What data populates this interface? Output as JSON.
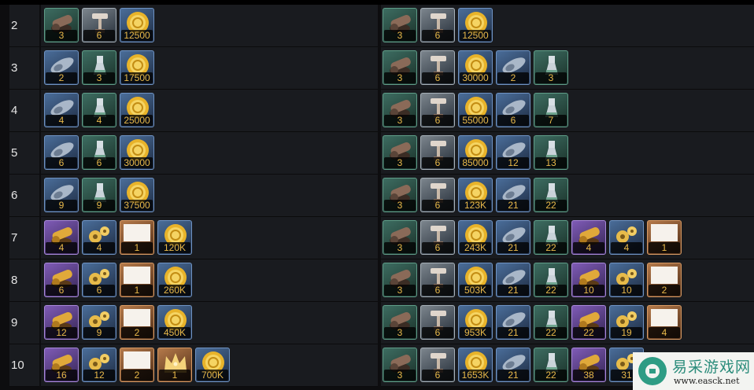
{
  "rows": [
    {
      "level": "2",
      "c1": [
        {
          "t": "cannon",
          "v": "3"
        },
        {
          "t": "pick",
          "v": "6"
        },
        {
          "t": "gold",
          "v": "12500"
        }
      ],
      "c2": [
        {
          "t": "cannon",
          "v": "3"
        },
        {
          "t": "pick",
          "v": "6"
        },
        {
          "t": "gold",
          "v": "12500"
        }
      ]
    },
    {
      "level": "3",
      "c1": [
        {
          "t": "shell",
          "v": "2"
        },
        {
          "t": "flask",
          "v": "3"
        },
        {
          "t": "gold",
          "v": "17500"
        }
      ],
      "c2": [
        {
          "t": "cannon",
          "v": "3"
        },
        {
          "t": "pick",
          "v": "6"
        },
        {
          "t": "gold",
          "v": "30000"
        },
        {
          "t": "shell",
          "v": "2"
        },
        {
          "t": "flask",
          "v": "3"
        }
      ]
    },
    {
      "level": "4",
      "c1": [
        {
          "t": "shell",
          "v": "4"
        },
        {
          "t": "flask",
          "v": "4"
        },
        {
          "t": "gold",
          "v": "25000"
        }
      ],
      "c2": [
        {
          "t": "cannon",
          "v": "3"
        },
        {
          "t": "pick",
          "v": "6"
        },
        {
          "t": "gold",
          "v": "55000"
        },
        {
          "t": "shell",
          "v": "6"
        },
        {
          "t": "flask",
          "v": "7"
        }
      ]
    },
    {
      "level": "5",
      "c1": [
        {
          "t": "shell",
          "v": "6"
        },
        {
          "t": "flask",
          "v": "6"
        },
        {
          "t": "gold",
          "v": "30000"
        }
      ],
      "c2": [
        {
          "t": "cannon",
          "v": "3"
        },
        {
          "t": "pick",
          "v": "6"
        },
        {
          "t": "gold",
          "v": "85000"
        },
        {
          "t": "shell",
          "v": "12"
        },
        {
          "t": "flask",
          "v": "13"
        }
      ]
    },
    {
      "level": "6",
      "c1": [
        {
          "t": "shell",
          "v": "9"
        },
        {
          "t": "flask",
          "v": "9"
        },
        {
          "t": "gold",
          "v": "37500"
        }
      ],
      "c2": [
        {
          "t": "cannon",
          "v": "3"
        },
        {
          "t": "pick",
          "v": "6"
        },
        {
          "t": "gold",
          "v": "123K"
        },
        {
          "t": "shell",
          "v": "21"
        },
        {
          "t": "flask",
          "v": "22"
        }
      ]
    },
    {
      "level": "7",
      "c1": [
        {
          "t": "goldcannon",
          "v": "4"
        },
        {
          "t": "goldgear",
          "v": "4"
        },
        {
          "t": "blank",
          "v": "1"
        },
        {
          "t": "gold",
          "v": "120K"
        }
      ],
      "c2": [
        {
          "t": "cannon",
          "v": "3"
        },
        {
          "t": "pick",
          "v": "6"
        },
        {
          "t": "gold",
          "v": "243K"
        },
        {
          "t": "shell",
          "v": "21"
        },
        {
          "t": "flask",
          "v": "22"
        },
        {
          "t": "goldcannon",
          "v": "4"
        },
        {
          "t": "goldgear",
          "v": "4"
        },
        {
          "t": "blank",
          "v": "1"
        }
      ]
    },
    {
      "level": "8",
      "c1": [
        {
          "t": "goldcannon",
          "v": "6"
        },
        {
          "t": "goldgear",
          "v": "6"
        },
        {
          "t": "blank",
          "v": "1"
        },
        {
          "t": "gold",
          "v": "260K"
        }
      ],
      "c2": [
        {
          "t": "cannon",
          "v": "3"
        },
        {
          "t": "pick",
          "v": "6"
        },
        {
          "t": "gold",
          "v": "503K"
        },
        {
          "t": "shell",
          "v": "21"
        },
        {
          "t": "flask",
          "v": "22"
        },
        {
          "t": "goldcannon",
          "v": "10"
        },
        {
          "t": "goldgear",
          "v": "10"
        },
        {
          "t": "blank",
          "v": "2"
        }
      ]
    },
    {
      "level": "9",
      "c1": [
        {
          "t": "goldcannon",
          "v": "12"
        },
        {
          "t": "goldgear",
          "v": "9"
        },
        {
          "t": "blank",
          "v": "2"
        },
        {
          "t": "gold",
          "v": "450K"
        }
      ],
      "c2": [
        {
          "t": "cannon",
          "v": "3"
        },
        {
          "t": "pick",
          "v": "6"
        },
        {
          "t": "gold",
          "v": "953K"
        },
        {
          "t": "shell",
          "v": "21"
        },
        {
          "t": "flask",
          "v": "22"
        },
        {
          "t": "goldcannon",
          "v": "22"
        },
        {
          "t": "goldgear",
          "v": "19"
        },
        {
          "t": "blank",
          "v": "4"
        }
      ]
    },
    {
      "level": "10",
      "c1": [
        {
          "t": "goldcannon",
          "v": "16"
        },
        {
          "t": "goldgear",
          "v": "12"
        },
        {
          "t": "blank",
          "v": "2"
        },
        {
          "t": "crown",
          "v": "1"
        },
        {
          "t": "gold",
          "v": "700K"
        }
      ],
      "c2": [
        {
          "t": "cannon",
          "v": "3"
        },
        {
          "t": "pick",
          "v": "6"
        },
        {
          "t": "gold",
          "v": "1653K"
        },
        {
          "t": "shell",
          "v": "21"
        },
        {
          "t": "flask",
          "v": "22"
        },
        {
          "t": "goldcannon",
          "v": "38"
        },
        {
          "t": "goldgear",
          "v": "31"
        }
      ]
    }
  ],
  "icon_types": {
    "cannon": {
      "name": "bronze-cannon-icon",
      "tier": "teal"
    },
    "pick": {
      "name": "hammer-pick-icon",
      "tier": "gray"
    },
    "gold": {
      "name": "gold-coin-icon",
      "tier": "blue"
    },
    "shell": {
      "name": "steel-shell-icon",
      "tier": "blue"
    },
    "flask": {
      "name": "flask-icon",
      "tier": "teal"
    },
    "goldcannon": {
      "name": "golden-cannon-icon",
      "tier": "purple"
    },
    "goldgear": {
      "name": "golden-gears-icon",
      "tier": "blue"
    },
    "blank": {
      "name": "blank-item-icon",
      "tier": "orange"
    },
    "crown": {
      "name": "crown-icon",
      "tier": "orange"
    }
  },
  "watermark": {
    "title": "易采游戏网",
    "url": "www.easck.net"
  },
  "colors": {
    "count_text": "#e9b94a",
    "row_bg": "#191b1f",
    "page_bg": "#0d0d0f"
  }
}
